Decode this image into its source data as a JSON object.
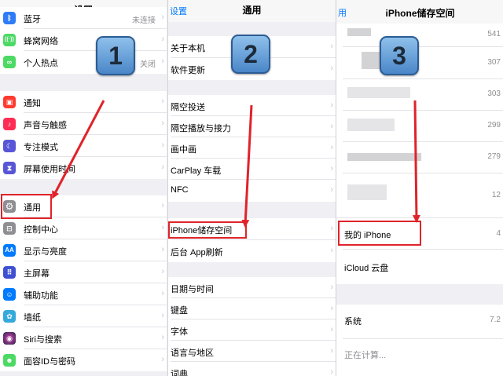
{
  "panel1": {
    "title": "设置",
    "badge": "1",
    "rows": [
      {
        "label": "蓝牙",
        "value": "未连接",
        "icon": "bluetooth-icon",
        "color": "#2f7cf6",
        "glyph": "ᛒ"
      },
      {
        "label": "蜂窝网络",
        "value": "",
        "icon": "cellular-icon",
        "color": "#4cd964",
        "glyph": "((·))"
      },
      {
        "label": "个人热点",
        "value": "关闭",
        "icon": "hotspot-icon",
        "color": "#4cd964",
        "glyph": "∞"
      },
      {
        "label": "通知",
        "value": "",
        "icon": "notifications-icon",
        "color": "#ff3b30",
        "glyph": "▣"
      },
      {
        "label": "声音与触感",
        "value": "",
        "icon": "sound-icon",
        "color": "#ff2d55",
        "glyph": "♪"
      },
      {
        "label": "专注模式",
        "value": "",
        "icon": "focus-moon-icon",
        "color": "#5856d6",
        "glyph": "☾"
      },
      {
        "label": "屏幕使用时间",
        "value": "",
        "icon": "screen-time-icon",
        "color": "#5856d6",
        "glyph": "⧗"
      },
      {
        "label": "通用",
        "value": "",
        "icon": "general-gear-icon",
        "color": "#8e8e93",
        "glyph": "⚙"
      },
      {
        "label": "控制中心",
        "value": "",
        "icon": "control-center-icon",
        "color": "#8e8e93",
        "glyph": "⊟"
      },
      {
        "label": "显示与亮度",
        "value": "",
        "icon": "display-icon",
        "color": "#007aff",
        "glyph": "AA"
      },
      {
        "label": "主屏幕",
        "value": "",
        "icon": "home-screen-icon",
        "color": "#3f51d1",
        "glyph": "⠿"
      },
      {
        "label": "辅助功能",
        "value": "",
        "icon": "accessibility-icon",
        "color": "#007aff",
        "glyph": "☺"
      },
      {
        "label": "墙纸",
        "value": "",
        "icon": "wallpaper-icon",
        "color": "#34aadc",
        "glyph": "✿"
      },
      {
        "label": "Siri与搜索",
        "value": "",
        "icon": "siri-icon",
        "color": "#222244",
        "glyph": "◉"
      },
      {
        "label": "面容ID与密码",
        "value": "",
        "icon": "face-id-icon",
        "color": "#4cd964",
        "glyph": "☻"
      }
    ]
  },
  "panel2": {
    "back": "设置",
    "title": "通用",
    "badge": "2",
    "rows": [
      {
        "label": "关于本机"
      },
      {
        "label": "软件更新"
      },
      {
        "label": "隔空投送"
      },
      {
        "label": "隔空播放与接力"
      },
      {
        "label": "画中画"
      },
      {
        "label": "CarPlay 车载"
      },
      {
        "label": "NFC"
      },
      {
        "label": "iPhone储存空间"
      },
      {
        "label": "后台 App刷新"
      },
      {
        "label": "日期与时间"
      },
      {
        "label": "键盘"
      },
      {
        "label": "字体"
      },
      {
        "label": "语言与地区"
      },
      {
        "label": "词典"
      }
    ]
  },
  "panel3": {
    "back": "用",
    "title": "iPhone储存空间",
    "badge": "3",
    "apps": [
      "541",
      "307",
      "303",
      "299",
      "279",
      "12"
    ],
    "my_iphone": {
      "label": "我的 iPhone",
      "value": "4"
    },
    "icloud": {
      "label": "iCloud 云盘"
    },
    "system": {
      "label": "系统",
      "value": "7.2"
    },
    "calculating": "正在计算..."
  },
  "colors": {
    "highlight": "#e0232a",
    "link": "#007aff"
  }
}
